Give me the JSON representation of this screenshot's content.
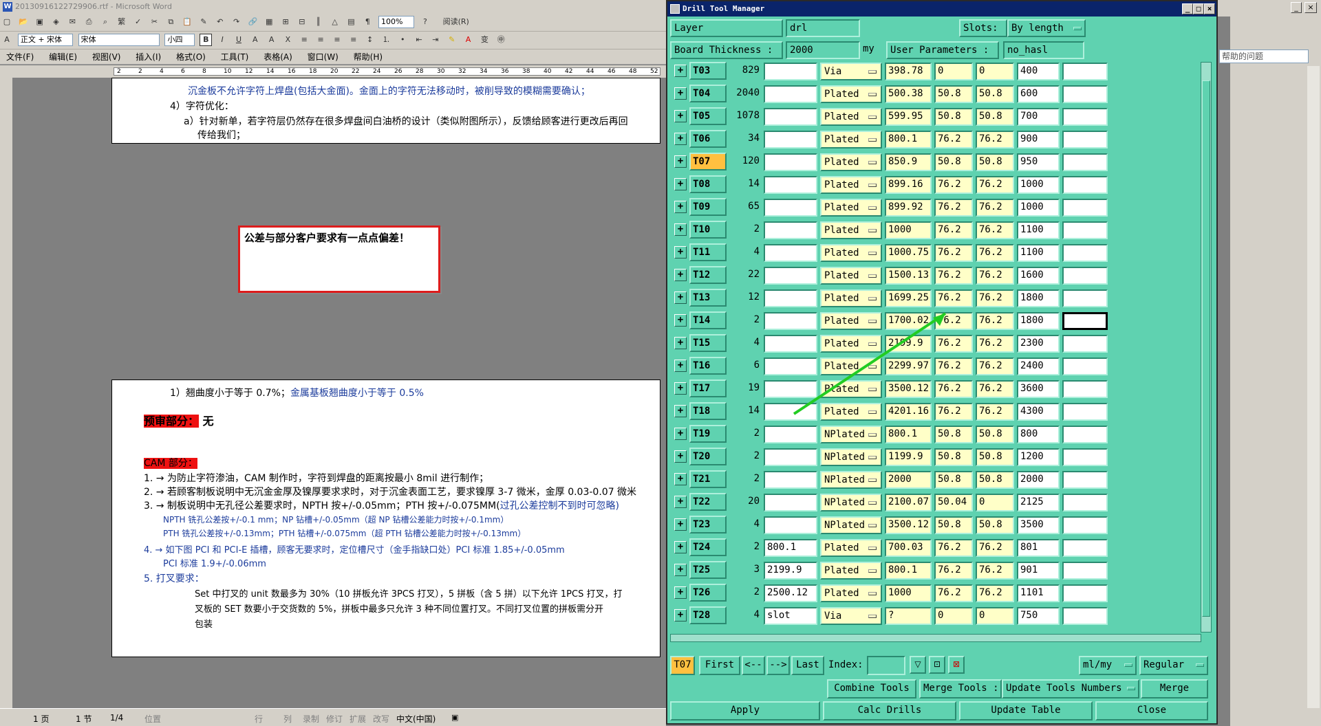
{
  "word": {
    "title": "20130916122729906.rtf - Microsoft Word",
    "style_select": "正文 + 宋体",
    "font_select": "宋体",
    "size_select": "小四",
    "zoom": "100%",
    "reading_label": "阅读(R)",
    "menu": [
      "文件(F)",
      "编辑(E)",
      "视图(V)",
      "插入(I)",
      "格式(O)",
      "工具(T)",
      "表格(A)",
      "窗口(W)",
      "帮助(H)"
    ],
    "ruler_ticks": [
      "2",
      "2",
      "4",
      "6",
      "8",
      "10",
      "12",
      "14",
      "16",
      "18",
      "20",
      "22",
      "24",
      "26",
      "28",
      "30",
      "32",
      "34",
      "36",
      "38",
      "40",
      "42",
      "44",
      "46",
      "48",
      "52"
    ],
    "page1": {
      "line1": "沉金板不允许字符上焊盘(包括大金面)。金面上的字符无法移动时，被削导致的模糊需要确认；",
      "line2": "4）字符优化：",
      "line3": "a）针对新单，若字符层仍然存在很多焊盘间白油桥的设计（类似附图所示），反馈给顾客进行更改后再回",
      "line4": "传给我们；"
    },
    "callout": "公差与部分客户要求有一点点偏差！",
    "page2": {
      "warp_a": "1）翘曲度小于等于 0.7%；",
      "warp_b": "金属基板翘曲度小于等于 0.5%",
      "pre_label": "预审部分：",
      "pre_value": " 无",
      "cam_label": "CAM 部分：",
      "c1": "1. → 为防止字符渗油，CAM 制作时，字符到焊盘的距离按最小 8mil 进行制作；",
      "c2": "2. → 若顾客制板说明中无沉金金厚及镍厚要求求时，对于沉金表面工艺，要求镍厚 3-7 微米，金厚 0.03-0.07 微米",
      "c3a": "3. → 制板说明中无孔径公差要求时，NPTH 按+/-0.05mm；PTH 按+/-0.075MM(",
      "c3b": "过孔公差控制不到时可忽略)",
      "c3c": "NPTH 铣孔公差按+/-0.1 mm；NP 钻槽+/-0.05mm（超 NP 钻槽公差能力时按+/-0.1mm）",
      "c3d": "PTH 铣孔公差按+/-0.13mm；PTH 钻槽+/-0.075mm（超 PTH 钻槽公差能力时按+/-0.13mm）",
      "c4a": "4. → 如下图 PCI 和 PCI-E 插槽，顾客无要求时，定位槽尺寸（金手指缺口处）PCI 标准 1.85+/-0.05mm",
      "c4b": "PCI 标准 1.9+/-0.06mm",
      "c5": "5. 打叉要求：",
      "c5a": "Set 中打叉的 unit 数最多为 30%（10 拼板允许 3PCS 打叉），5 拼板（含 5 拼）以下允许 1PCS 打叉，打",
      "c5b": "叉板的 SET 数要小于交货数的 5%，拼板中最多只允许 3 种不同位置打叉。不同打叉位置的拼板需分开",
      "c5c": "包装"
    },
    "status": {
      "page": "1 页",
      "section": "1 节",
      "pages": "1/4",
      "pos": "位置",
      "line": "行",
      "col": "列",
      "rec": "录制",
      "rev": "修订",
      "ext": "扩展",
      "ovr": "改写",
      "lang": "中文(中国)"
    }
  },
  "right_panel": {
    "help_placeholder": "帮助的问题"
  },
  "dtm": {
    "title": "Drill Tool Manager",
    "layer_label": "Layer",
    "layer_value": "drl",
    "slots_label": "Slots:",
    "slots_value": "By length",
    "thickness_label": "Board Thickness :",
    "thickness_value": "2000",
    "thickness_unit": "my",
    "userparam_label": "User Parameters :",
    "userparam_value": "no_hasl",
    "rows": [
      {
        "tool": "T03",
        "count": "829",
        "c1": "",
        "type": "Via",
        "size": "398.78",
        "p1": "0",
        "p2": "0",
        "fin": "400",
        "c2": ""
      },
      {
        "tool": "T04",
        "count": "2040",
        "c1": "",
        "type": "Plated",
        "size": "500.38",
        "p1": "50.8",
        "p2": "50.8",
        "fin": "600",
        "c2": ""
      },
      {
        "tool": "T05",
        "count": "1078",
        "c1": "",
        "type": "Plated",
        "size": "599.95",
        "p1": "50.8",
        "p2": "50.8",
        "fin": "700",
        "c2": ""
      },
      {
        "tool": "T06",
        "count": "34",
        "c1": "",
        "type": "Plated",
        "size": "800.1",
        "p1": "76.2",
        "p2": "76.2",
        "fin": "900",
        "c2": ""
      },
      {
        "tool": "T07",
        "count": "120",
        "c1": "",
        "type": "Plated",
        "size": "850.9",
        "p1": "50.8",
        "p2": "50.8",
        "fin": "950",
        "c2": ""
      },
      {
        "tool": "T08",
        "count": "14",
        "c1": "",
        "type": "Plated",
        "size": "899.16",
        "p1": "76.2",
        "p2": "76.2",
        "fin": "1000",
        "c2": ""
      },
      {
        "tool": "T09",
        "count": "65",
        "c1": "",
        "type": "Plated",
        "size": "899.92",
        "p1": "76.2",
        "p2": "76.2",
        "fin": "1000",
        "c2": ""
      },
      {
        "tool": "T10",
        "count": "2",
        "c1": "",
        "type": "Plated",
        "size": "1000",
        "p1": "76.2",
        "p2": "76.2",
        "fin": "1100",
        "c2": ""
      },
      {
        "tool": "T11",
        "count": "4",
        "c1": "",
        "type": "Plated",
        "size": "1000.75",
        "p1": "76.2",
        "p2": "76.2",
        "fin": "1100",
        "c2": ""
      },
      {
        "tool": "T12",
        "count": "22",
        "c1": "",
        "type": "Plated",
        "size": "1500.13",
        "p1": "76.2",
        "p2": "76.2",
        "fin": "1600",
        "c2": ""
      },
      {
        "tool": "T13",
        "count": "12",
        "c1": "",
        "type": "Plated",
        "size": "1699.25",
        "p1": "76.2",
        "p2": "76.2",
        "fin": "1800",
        "c2": ""
      },
      {
        "tool": "T14",
        "count": "2",
        "c1": "",
        "type": "Plated",
        "size": "1700.02",
        "p1": "76.2",
        "p2": "76.2",
        "fin": "1800",
        "c2": ""
      },
      {
        "tool": "T15",
        "count": "4",
        "c1": "",
        "type": "Plated",
        "size": "2199.9",
        "p1": "76.2",
        "p2": "76.2",
        "fin": "2300",
        "c2": ""
      },
      {
        "tool": "T16",
        "count": "6",
        "c1": "",
        "type": "Plated",
        "size": "2299.97",
        "p1": "76.2",
        "p2": "76.2",
        "fin": "2400",
        "c2": ""
      },
      {
        "tool": "T17",
        "count": "19",
        "c1": "",
        "type": "Plated",
        "size": "3500.12",
        "p1": "76.2",
        "p2": "76.2",
        "fin": "3600",
        "c2": ""
      },
      {
        "tool": "T18",
        "count": "14",
        "c1": "",
        "type": "Plated",
        "size": "4201.16",
        "p1": "76.2",
        "p2": "76.2",
        "fin": "4300",
        "c2": ""
      },
      {
        "tool": "T19",
        "count": "2",
        "c1": "",
        "type": "NPlated",
        "size": "800.1",
        "p1": "50.8",
        "p2": "50.8",
        "fin": "800",
        "c2": ""
      },
      {
        "tool": "T20",
        "count": "2",
        "c1": "",
        "type": "NPlated",
        "size": "1199.9",
        "p1": "50.8",
        "p2": "50.8",
        "fin": "1200",
        "c2": ""
      },
      {
        "tool": "T21",
        "count": "2",
        "c1": "",
        "type": "NPlated",
        "size": "2000",
        "p1": "50.8",
        "p2": "50.8",
        "fin": "2000",
        "c2": ""
      },
      {
        "tool": "T22",
        "count": "20",
        "c1": "",
        "type": "NPlated",
        "size": "2100.07",
        "p1": "50.04",
        "p2": "0",
        "fin": "2125",
        "c2": ""
      },
      {
        "tool": "T23",
        "count": "4",
        "c1": "",
        "type": "NPlated",
        "size": "3500.12",
        "p1": "50.8",
        "p2": "50.8",
        "fin": "3500",
        "c2": ""
      },
      {
        "tool": "T24",
        "count": "2",
        "c1": "800.1",
        "type": "Plated",
        "size": "700.03",
        "p1": "76.2",
        "p2": "76.2",
        "fin": "801",
        "c2": ""
      },
      {
        "tool": "T25",
        "count": "3",
        "c1": "2199.9",
        "type": "Plated",
        "size": "800.1",
        "p1": "76.2",
        "p2": "76.2",
        "fin": "901",
        "c2": ""
      },
      {
        "tool": "T26",
        "count": "2",
        "c1": "2500.12",
        "type": "Plated",
        "size": "1000",
        "p1": "76.2",
        "p2": "76.2",
        "fin": "1101",
        "c2": ""
      },
      {
        "tool": "T28",
        "count": "4",
        "c1": "slot",
        "type": "Via",
        "size": "?",
        "p1": "0",
        "p2": "0",
        "fin": "750",
        "c2": ""
      }
    ],
    "nav": {
      "current": "T07",
      "first": "First",
      "prev": "<--",
      "next": "-->",
      "last": "Last",
      "index_label": "Index:",
      "index_value": "",
      "units": "ml/my",
      "mode": "Regular"
    },
    "actions": {
      "combine": "Combine Tools",
      "merge_tools": "Merge Tools :",
      "update_numbers": "Update Tools Numbers",
      "merge": "Merge",
      "apply": "Apply",
      "calc": "Calc Drills",
      "update_table": "Update Table",
      "close": "Close"
    }
  },
  "colors": {
    "dtm_bg": "#5fd2b0",
    "selected_tool": "#ffc040",
    "field_yellow": "#ffffc8",
    "arrow": "#22cc22",
    "callout_border": "#dd1c1c"
  }
}
